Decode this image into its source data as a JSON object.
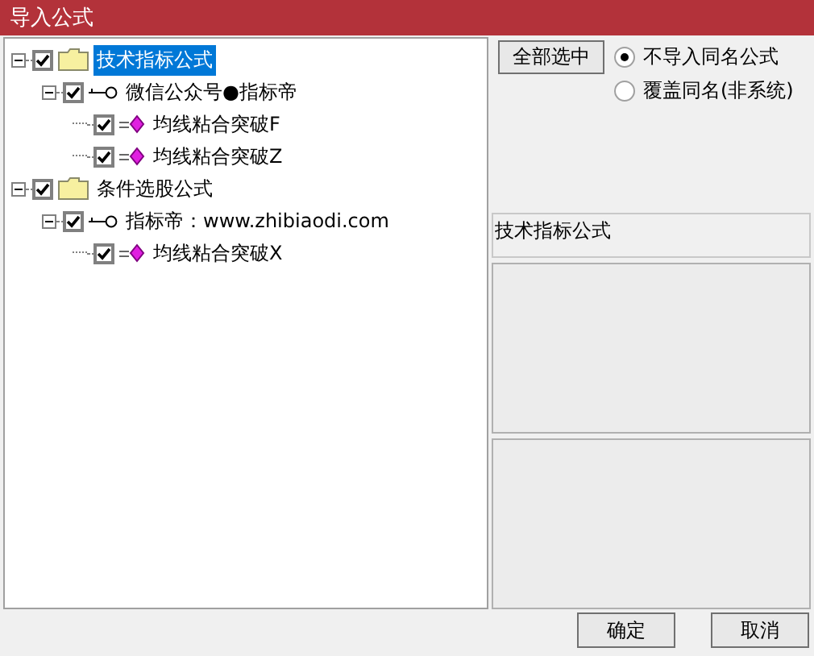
{
  "window": {
    "title": "导入公式"
  },
  "tree": [
    {
      "kind": "folder",
      "label": "技术指标公式",
      "checked": true,
      "expanded": true,
      "selected": true,
      "children": [
        {
          "kind": "key",
          "label": "微信公众号●指标帝",
          "checked": true,
          "expanded": true,
          "selected": false,
          "children": [
            {
              "kind": "formula",
              "label": "均线粘合突破F",
              "checked": true,
              "selected": false
            },
            {
              "kind": "formula",
              "label": "均线粘合突破Z",
              "checked": true,
              "selected": false
            }
          ]
        }
      ]
    },
    {
      "kind": "folder",
      "label": "条件选股公式",
      "checked": true,
      "expanded": true,
      "selected": false,
      "children": [
        {
          "kind": "key",
          "label": "指标帝：www.zhibiaodi.com",
          "checked": true,
          "expanded": true,
          "selected": false,
          "children": [
            {
              "kind": "formula",
              "label": "均线粘合突破X",
              "checked": true,
              "selected": false
            }
          ]
        }
      ]
    }
  ],
  "select_all_button": "全部选中",
  "import_options": [
    {
      "label": "不导入同名公式",
      "selected": true
    },
    {
      "label": "覆盖同名(非系统)",
      "selected": false
    }
  ],
  "category_label": "技术指标公式",
  "buttons": [
    {
      "label": "确定"
    },
    {
      "label": "取消"
    }
  ]
}
